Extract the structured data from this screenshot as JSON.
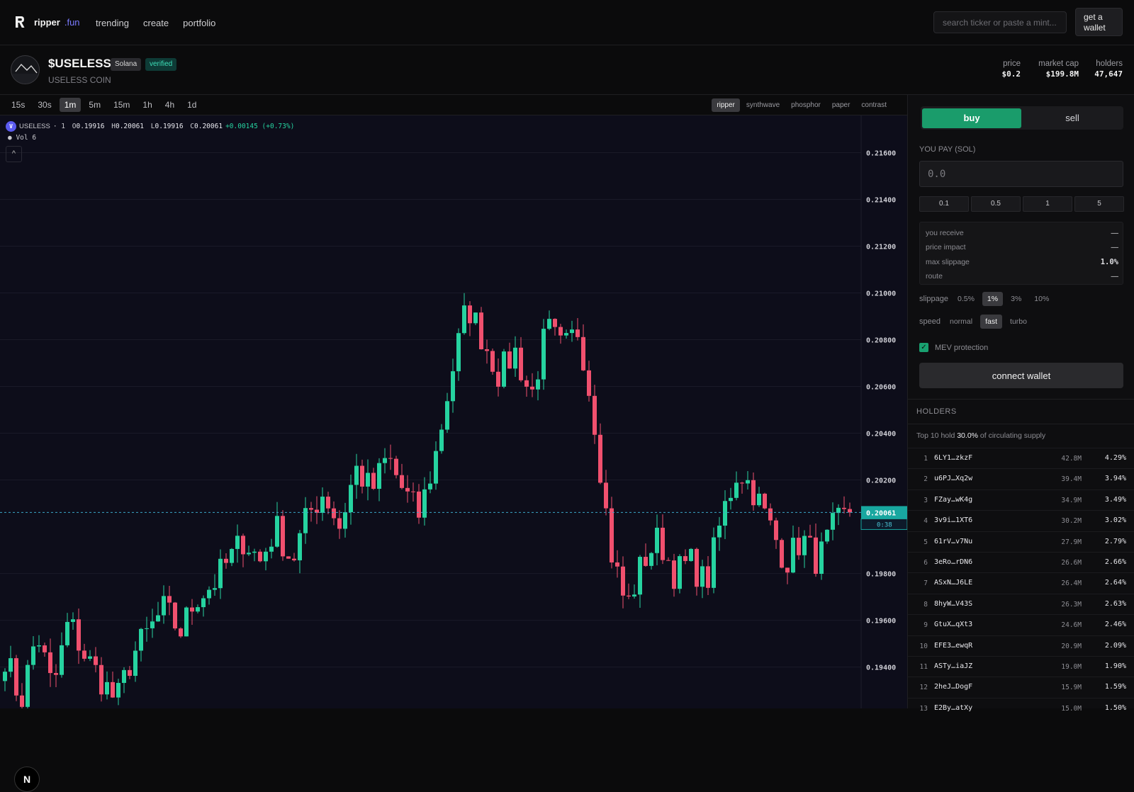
{
  "nav": {
    "brand": "ripper",
    "brand_suffix": ".fun",
    "links": [
      "trending",
      "create",
      "portfolio"
    ],
    "search_placeholder": "search ticker or paste a mint...",
    "wallet_button": "get a wallet"
  },
  "token": {
    "ticker": "$USELESS",
    "chain": "Solana",
    "verified": "verified",
    "name": "USELESS COIN",
    "stats": [
      {
        "label": "price",
        "value": "$0.2"
      },
      {
        "label": "market cap",
        "value": "$199.8M"
      },
      {
        "label": "holders",
        "value": "47,647"
      }
    ]
  },
  "toolbar": {
    "intervals": [
      "15s",
      "30s",
      "1m",
      "5m",
      "15m",
      "1h",
      "4h",
      "1d"
    ],
    "active_interval": "1m",
    "themes": [
      "ripper",
      "synthwave",
      "phosphor",
      "paper",
      "contrast"
    ],
    "active_theme": "ripper"
  },
  "legend": {
    "icon_letter": "V",
    "symbol": "USELESS",
    "interval": "· 1",
    "o_label": "O",
    "o": "0.19916",
    "h_label": "H",
    "h": "0.20061",
    "l_label": "L",
    "l": "0.19916",
    "c_label": "C",
    "c": "0.20061",
    "change": "+0.00145 (+0.73%)",
    "volume": "Vol 6",
    "badge_letter": "N"
  },
  "chart_data": {
    "type": "candlestick",
    "y_ticks": [
      0.216,
      0.214,
      0.212,
      0.21,
      0.208,
      0.206,
      0.204,
      0.202,
      0.198,
      0.196,
      0.194
    ],
    "y_tick_labels": [
      "0.21600",
      "0.21400",
      "0.21200",
      "0.21000",
      "0.20800",
      "0.20600",
      "0.20400",
      "0.20200",
      "0.19800",
      "0.19600",
      "0.19400"
    ],
    "ylim": [
      0.19223,
      0.21759
    ],
    "last_price": 0.20061,
    "last_price_label": "0.20061",
    "countdown": "0:38",
    "colors": {
      "up": "#26d3a0",
      "down": "#f0506e",
      "background": "#0d0d1a",
      "grid": "#1a1a28",
      "price_line": "#3aa6c8"
    },
    "anchors": [
      0.1945,
      0.1925,
      0.1955,
      0.193,
      0.196,
      0.1945,
      0.1935,
      0.1925,
      0.1945,
      0.1955,
      0.1965,
      0.1955,
      0.197,
      0.1975,
      0.1985,
      0.1995,
      0.1985,
      0.2,
      0.1985,
      0.2005,
      0.2015,
      0.2,
      0.2025,
      0.2015,
      0.203,
      0.2015,
      0.2005,
      0.203,
      0.2065,
      0.2095,
      0.208,
      0.2065,
      0.2075,
      0.2055,
      0.2085,
      0.2075,
      0.2085,
      0.2045,
      0.199,
      0.1965,
      0.1985,
      0.1995,
      0.198,
      0.1985,
      0.1975,
      0.2005,
      0.2025,
      0.2015,
      0.2,
      0.1985,
      0.1995,
      0.1985,
      0.2,
      0.2006
    ]
  },
  "trade": {
    "buy_tab": "buy",
    "sell_tab": "sell",
    "pay_label": "YOU PAY (SOL)",
    "amount_placeholder": "0.0",
    "quick_amounts": [
      "0.1",
      "0.5",
      "1",
      "5"
    ],
    "summary": [
      {
        "label": "you receive",
        "value": "—"
      },
      {
        "label": "price impact",
        "value": "—"
      },
      {
        "label": "max slippage",
        "value": "1.0%"
      },
      {
        "label": "route",
        "value": "—"
      }
    ],
    "slippage_label": "slippage",
    "slippage_options": [
      "0.5%",
      "1%",
      "3%",
      "10%"
    ],
    "slippage_active": "1%",
    "speed_label": "speed",
    "speed_options": [
      "normal",
      "fast",
      "turbo"
    ],
    "speed_active": "fast",
    "mev_label": "MEV protection",
    "mev_enabled": true,
    "connect_button": "connect wallet"
  },
  "holders": {
    "title": "HOLDERS",
    "summary_prefix": "Top 10 hold",
    "summary_value": "30.0%",
    "summary_suffix": "of circulating supply",
    "rows": [
      {
        "rank": "1",
        "address": "6LY1…zkzF",
        "amount": "42.8M",
        "percent": "4.29%"
      },
      {
        "rank": "2",
        "address": "u6PJ…Xq2w",
        "amount": "39.4M",
        "percent": "3.94%"
      },
      {
        "rank": "3",
        "address": "FZay…wK4g",
        "amount": "34.9M",
        "percent": "3.49%"
      },
      {
        "rank": "4",
        "address": "3v9i…1XT6",
        "amount": "30.2M",
        "percent": "3.02%"
      },
      {
        "rank": "5",
        "address": "61rV…v7Nu",
        "amount": "27.9M",
        "percent": "2.79%"
      },
      {
        "rank": "6",
        "address": "3eRo…rDN6",
        "amount": "26.6M",
        "percent": "2.66%"
      },
      {
        "rank": "7",
        "address": "ASxN…J6LE",
        "amount": "26.4M",
        "percent": "2.64%"
      },
      {
        "rank": "8",
        "address": "8hyW…V43S",
        "amount": "26.3M",
        "percent": "2.63%"
      },
      {
        "rank": "9",
        "address": "GtuX…qXt3",
        "amount": "24.6M",
        "percent": "2.46%"
      },
      {
        "rank": "10",
        "address": "EFE3…ewqR",
        "amount": "20.9M",
        "percent": "2.09%"
      },
      {
        "rank": "11",
        "address": "ASTy…iaJZ",
        "amount": "19.0M",
        "percent": "1.90%"
      },
      {
        "rank": "12",
        "address": "2heJ…DogF",
        "amount": "15.9M",
        "percent": "1.59%"
      },
      {
        "rank": "13",
        "address": "E2By…atXy",
        "amount": "15.0M",
        "percent": "1.50%"
      }
    ]
  }
}
